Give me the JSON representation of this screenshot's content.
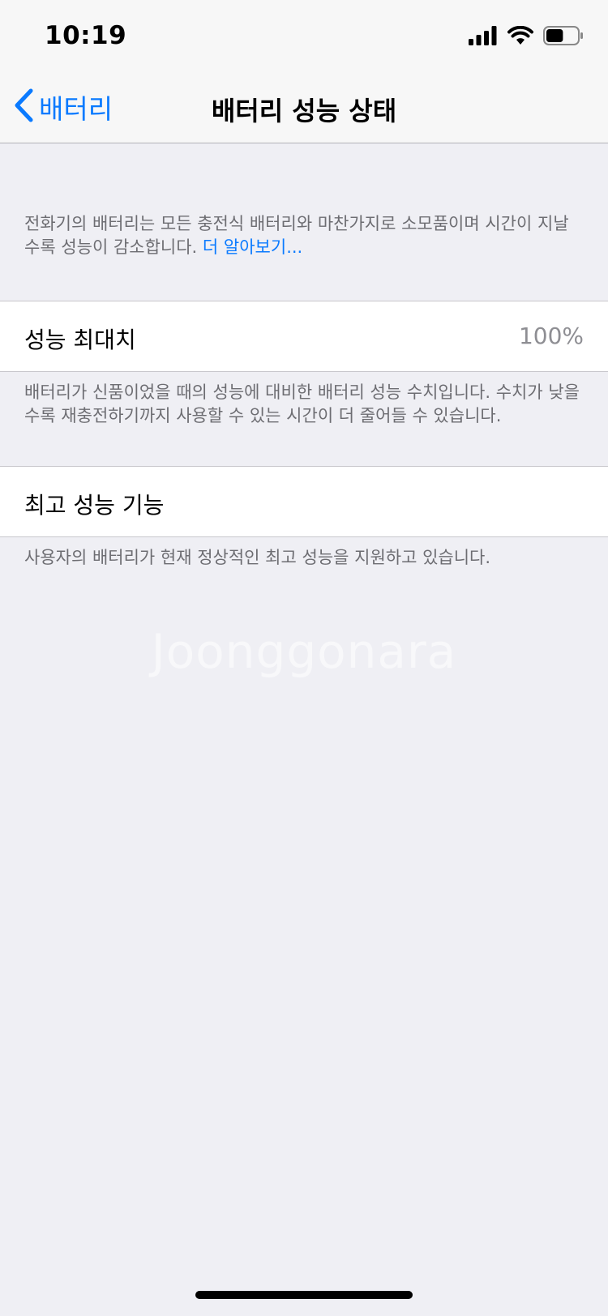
{
  "status_bar": {
    "time": "10:19",
    "battery_level": 0.55
  },
  "nav": {
    "back_label": "배터리",
    "title": "배터리 성능 상태"
  },
  "intro": {
    "text": "전화기의 배터리는 모든 충전식 배터리와 마찬가지로 소모품이며 시간이 지날수록 성능이 감소합니다.",
    "link": "더 알아보기..."
  },
  "max_capacity": {
    "label": "성능 최대치",
    "value": "100%",
    "footer": "배터리가 신품이었을 때의 성능에 대비한 배터리 성능 수치입니다. 수치가 낮을수록 재충전하기까지 사용할 수 있는 시간이 더 줄어들 수 있습니다."
  },
  "peak_performance": {
    "label": "최고 성능 기능",
    "footer": "사용자의 배터리가 현재 정상적인 최고 성능을 지원하고 있습니다."
  },
  "watermark": "Joonggonara",
  "colors": {
    "accent": "#0a7aff",
    "background": "#efeff4",
    "secondary_text": "#6d6d72"
  }
}
